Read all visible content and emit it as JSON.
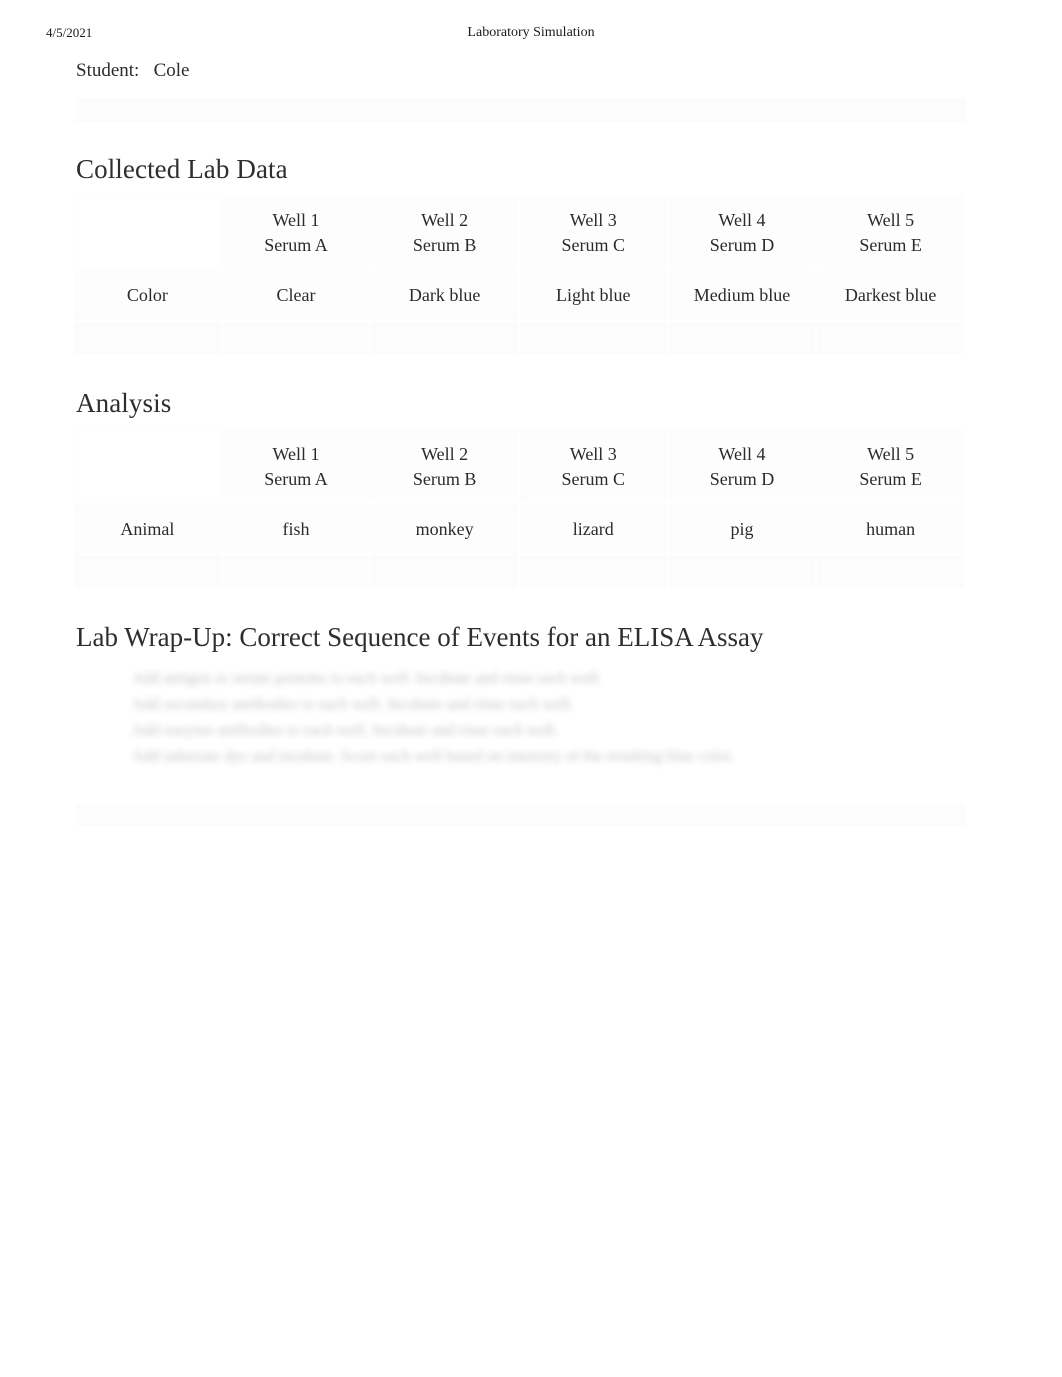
{
  "print_header": {
    "date": "4/5/2021",
    "title": "Laboratory Simulation"
  },
  "student": {
    "label": "Student:",
    "name": "Cole",
    "line": "Student:   Cole"
  },
  "collected_lab_data": {
    "heading": "Collected Lab Data",
    "corner_label": "",
    "row_label": "Color",
    "columns": [
      {
        "well": "Well 1",
        "serum": "Serum A"
      },
      {
        "well": "Well 2",
        "serum": "Serum B"
      },
      {
        "well": "Well 3",
        "serum": "Serum C"
      },
      {
        "well": "Well 4",
        "serum": "Serum D"
      },
      {
        "well": "Well 5",
        "serum": "Serum E"
      }
    ],
    "values": [
      "Clear",
      "Dark blue",
      "Light blue",
      "Medium blue",
      "Darkest blue"
    ]
  },
  "analysis": {
    "heading": "Analysis",
    "corner_label": "",
    "row_label": "Animal",
    "columns": [
      {
        "well": "Well 1",
        "serum": "Serum A"
      },
      {
        "well": "Well 2",
        "serum": "Serum B"
      },
      {
        "well": "Well 3",
        "serum": "Serum C"
      },
      {
        "well": "Well 4",
        "serum": "Serum D"
      },
      {
        "well": "Well 5",
        "serum": "Serum E"
      }
    ],
    "values": [
      "fish",
      "monkey",
      "lizard",
      "pig",
      "human"
    ]
  },
  "wrapup": {
    "heading": "Lab Wrap-Up: Correct Sequence of Events for an ELISA Assay",
    "steps": [
      "Add antigen or serum proteins to each well. Incubate and rinse each well.",
      "Add secondary antibodies to each well. Incubate and rinse each well.",
      "Add enzyme antibodies to each well. Incubate and rinse each well.",
      "Add substrate dye and incubate. Score each well based on intensity of the resulting blue color."
    ]
  }
}
